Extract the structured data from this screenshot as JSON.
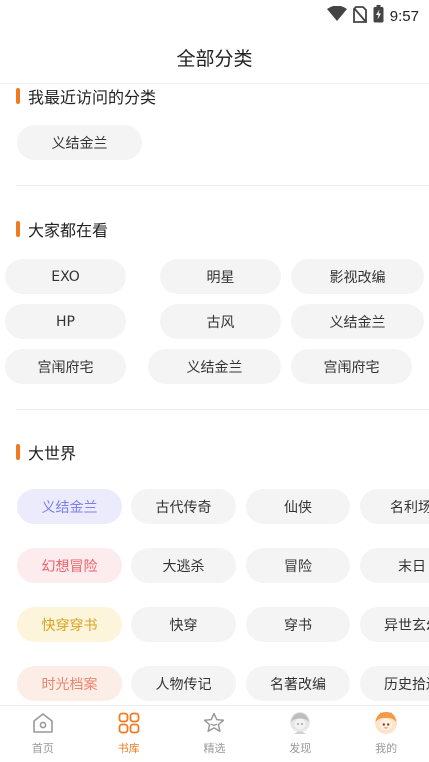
{
  "status_bar": {
    "time": "9:57",
    "icons": [
      "wifi-icon",
      "no-sim-icon",
      "battery-charging-icon"
    ]
  },
  "header": {
    "title": "全部分类"
  },
  "sections": {
    "recent": {
      "title": "我最近访问的分类",
      "items": [
        "义结金兰"
      ]
    },
    "popular": {
      "title": "大家都在看",
      "items": [
        "EXO",
        "明星",
        "影视改编",
        "HP",
        "古风",
        "义结金兰",
        "宫闱府宅",
        "义结金兰",
        "宫闱府宅"
      ]
    },
    "world": {
      "title": "大世界",
      "rows": [
        {
          "tag": "义结金兰",
          "tag_color": "#7b7fe6",
          "tag_bg": "#ecebfb",
          "items": [
            "古代传奇",
            "仙侠",
            "名利场"
          ]
        },
        {
          "tag": "幻想冒险",
          "tag_color": "#ec5f6a",
          "tag_bg": "#fdeced",
          "items": [
            "大逃杀",
            "冒险",
            "末日"
          ]
        },
        {
          "tag": "快穿穿书",
          "tag_color": "#d9a21b",
          "tag_bg": "#fdf4dc",
          "items": [
            "快穿",
            "穿书",
            "异世玄幻"
          ]
        },
        {
          "tag": "时光档案",
          "tag_color": "#e9866b",
          "tag_bg": "#fcede7",
          "items": [
            "人物传记",
            "名著改编",
            "历史拾遗"
          ]
        }
      ]
    }
  },
  "bottom_nav": {
    "items": [
      {
        "label": "首页",
        "icon": "home-icon",
        "active": false
      },
      {
        "label": "书库",
        "icon": "grid-icon",
        "active": true
      },
      {
        "label": "精选",
        "icon": "star-icon",
        "active": false
      },
      {
        "label": "发现",
        "icon": "character-avatar-icon",
        "active": false
      },
      {
        "label": "我的",
        "icon": "user-avatar-icon",
        "active": false
      }
    ]
  },
  "colors": {
    "accent": "#f07a22",
    "chip_bg": "#f4f4f4",
    "inactive_nav": "#999999"
  }
}
